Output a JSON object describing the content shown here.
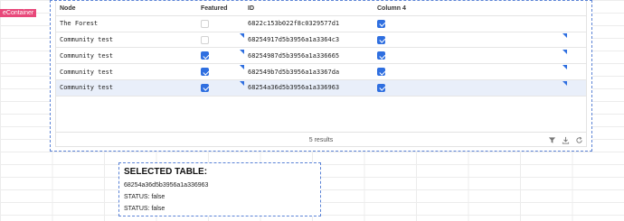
{
  "container_tag": "eContainer",
  "table": {
    "columns": [
      "Node",
      "Featured",
      "ID",
      "Column 4"
    ],
    "rows": [
      {
        "node": "The Forest",
        "featured": false,
        "id": "6822c153b022f8c0329577d1",
        "col4": true
      },
      {
        "node": "Community test",
        "featured": false,
        "id": "68254917d5b3956a1a3364c3",
        "col4": true
      },
      {
        "node": "Community test",
        "featured": true,
        "id": "68254987d5b3956a1a336665",
        "col4": true
      },
      {
        "node": "Community test",
        "featured": true,
        "id": "682549b7d5b3956a1a3367da",
        "col4": true
      },
      {
        "node": "Community test",
        "featured": true,
        "id": "68254a36d5b3956a1a336963",
        "col4": true
      }
    ],
    "selected_row_index": 4,
    "results_text": "5 results",
    "footer_icons": [
      "filter-icon",
      "download-icon",
      "refresh-icon"
    ]
  },
  "selected_panel": {
    "title": "SELECTED TABLE:",
    "selected_id": "68254a36d5b3956a1a336963",
    "status_1": "STATUS: false",
    "status_2": "STATUS: false"
  },
  "colors": {
    "accent": "#2f6fe0",
    "selected_row": "#e9effa",
    "container_tag": "#e8487a",
    "dashed_outline": "#5b83d6"
  }
}
